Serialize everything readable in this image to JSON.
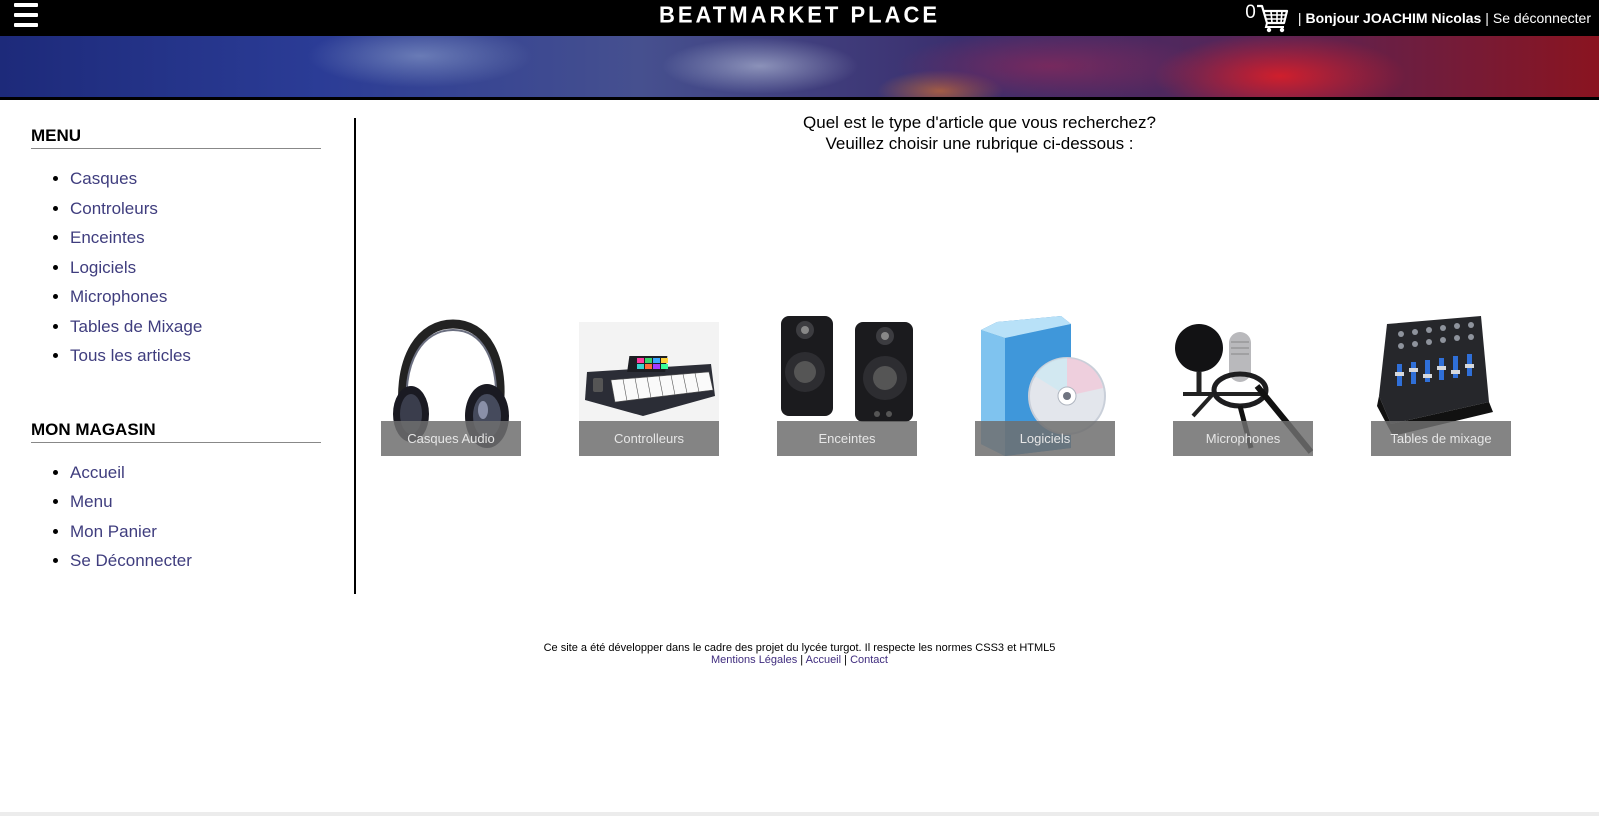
{
  "header": {
    "title": "BEATMARKET PLACE",
    "cart_count": "0",
    "separator": "|",
    "greeting": "Bonjour JOACHIM Nicolas",
    "logout": "Se déconnecter"
  },
  "sidebar": {
    "menu_heading": "MENU",
    "menu_items": [
      "Casques",
      "Controleurs",
      "Enceintes",
      "Logiciels",
      "Microphones",
      "Tables de Mixage",
      "Tous les articles"
    ],
    "shop_heading": "MON MAGASIN",
    "shop_items": [
      "Accueil",
      "Menu",
      "Mon Panier",
      "Se Déconnecter"
    ]
  },
  "main": {
    "intro_line1": "Quel est le type d'article que vous recherchez?",
    "intro_line2": "Veuillez choisir une rubrique ci-dessous :",
    "categories": [
      {
        "label": "Casques Audio",
        "icon": "headphones-icon"
      },
      {
        "label": "Controlleurs",
        "icon": "midi-keyboard-icon"
      },
      {
        "label": "Enceintes",
        "icon": "speakers-icon"
      },
      {
        "label": "Logiciels",
        "icon": "software-box-icon"
      },
      {
        "label": "Microphones",
        "icon": "microphone-icon"
      },
      {
        "label": "Tables de mixage",
        "icon": "mixing-desk-icon"
      }
    ]
  },
  "footer": {
    "text": "Ce site a été développer dans le cadre des projet du lycée turgot. Il respecte les normes CSS3 et HTML5",
    "link_legal": "Mentions Légales",
    "link_home": "Accueil",
    "link_contact": "Contact",
    "separator": "|"
  },
  "colors": {
    "topbar": "#000000",
    "link": "#3f3d7e",
    "label_overlay": "#6e6e6e"
  }
}
